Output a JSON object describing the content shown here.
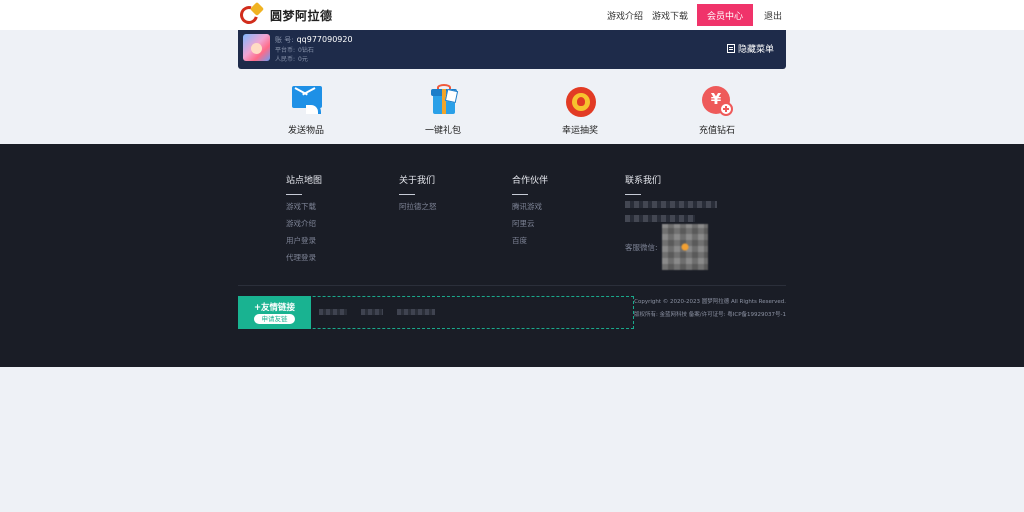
{
  "header": {
    "logo_text": "圆梦阿拉德",
    "nav": {
      "intro": "游戏介绍",
      "download": "游戏下载",
      "member_center": "会员中心",
      "logout": "退出"
    },
    "accent_color": "#f0336a"
  },
  "account": {
    "account_label": "账 号:",
    "account_value": "qq977090920",
    "platform_coin_label": "平台币:",
    "platform_coin_value": "0钻石",
    "rmb_label": "人民币:",
    "rmb_value": "0元",
    "hide_menu": "隐藏菜单"
  },
  "quick_actions": [
    {
      "label": "发送物品",
      "icon": "send-mail-icon"
    },
    {
      "label": "一键礼包",
      "icon": "gift-icon"
    },
    {
      "label": "幸运抽奖",
      "icon": "lucky-draw-icon"
    },
    {
      "label": "充值钻石",
      "icon": "recharge-icon"
    }
  ],
  "footer": {
    "site_map": {
      "title": "站点地图",
      "links": [
        "游戏下载",
        "游戏介绍",
        "用户登录",
        "代理登录"
      ]
    },
    "about": {
      "title": "关于我们",
      "links": [
        "阿拉德之怒"
      ]
    },
    "partners": {
      "title": "合作伙伴",
      "links": [
        "腾讯游戏",
        "阿里云",
        "百度"
      ]
    },
    "contact": {
      "title": "联系我们",
      "wechat_label": "客服微信:"
    },
    "friend_links": {
      "title": "+友情链接",
      "apply": "申请友链"
    },
    "copyright": "Copyright © 2020-2023 圆梦阿拉德 All Rights Reserved.",
    "license": "版权所有: 金蓝网科技 备案/许可证号: 粤ICP备19929037号-1"
  }
}
